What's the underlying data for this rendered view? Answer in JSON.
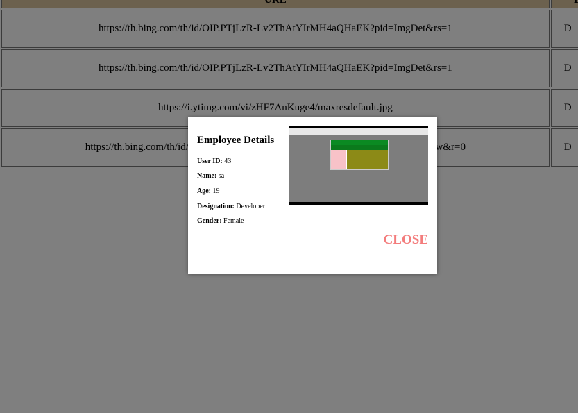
{
  "table": {
    "header": [
      "URL",
      "D"
    ],
    "rows": [
      {
        "url": "https://th.bing.com/th/id/OIP.PTjLzR-Lv2ThAtYIrMH4aQHaEK?pid=ImgDet&rs=1",
        "extra": "D"
      },
      {
        "url": "https://th.bing.com/th/id/OIP.PTjLzR-Lv2ThAtYIrMH4aQHaEK?pid=ImgDet&rs=1",
        "extra": "D"
      },
      {
        "url": "https://i.ytimg.com/vi/zHF7AnKuge4/maxresdefault.jpg",
        "extra": "D"
      },
      {
        "url": "https://th.bing.com/th/id/R.e911ca637cf2                                                          ImgRaw&r=0",
        "extra": "D"
      }
    ]
  },
  "modal": {
    "title": "Employee Details",
    "fields": [
      {
        "label": "User ID:",
        "value": "43"
      },
      {
        "label": "Name:",
        "value": "sa"
      },
      {
        "label": "Age:",
        "value": "19"
      },
      {
        "label": "Designation:",
        "value": "Developer"
      },
      {
        "label": "Gender:",
        "value": "Female"
      }
    ],
    "close_label": "CLOSE",
    "close_color": "#f37c7c"
  }
}
